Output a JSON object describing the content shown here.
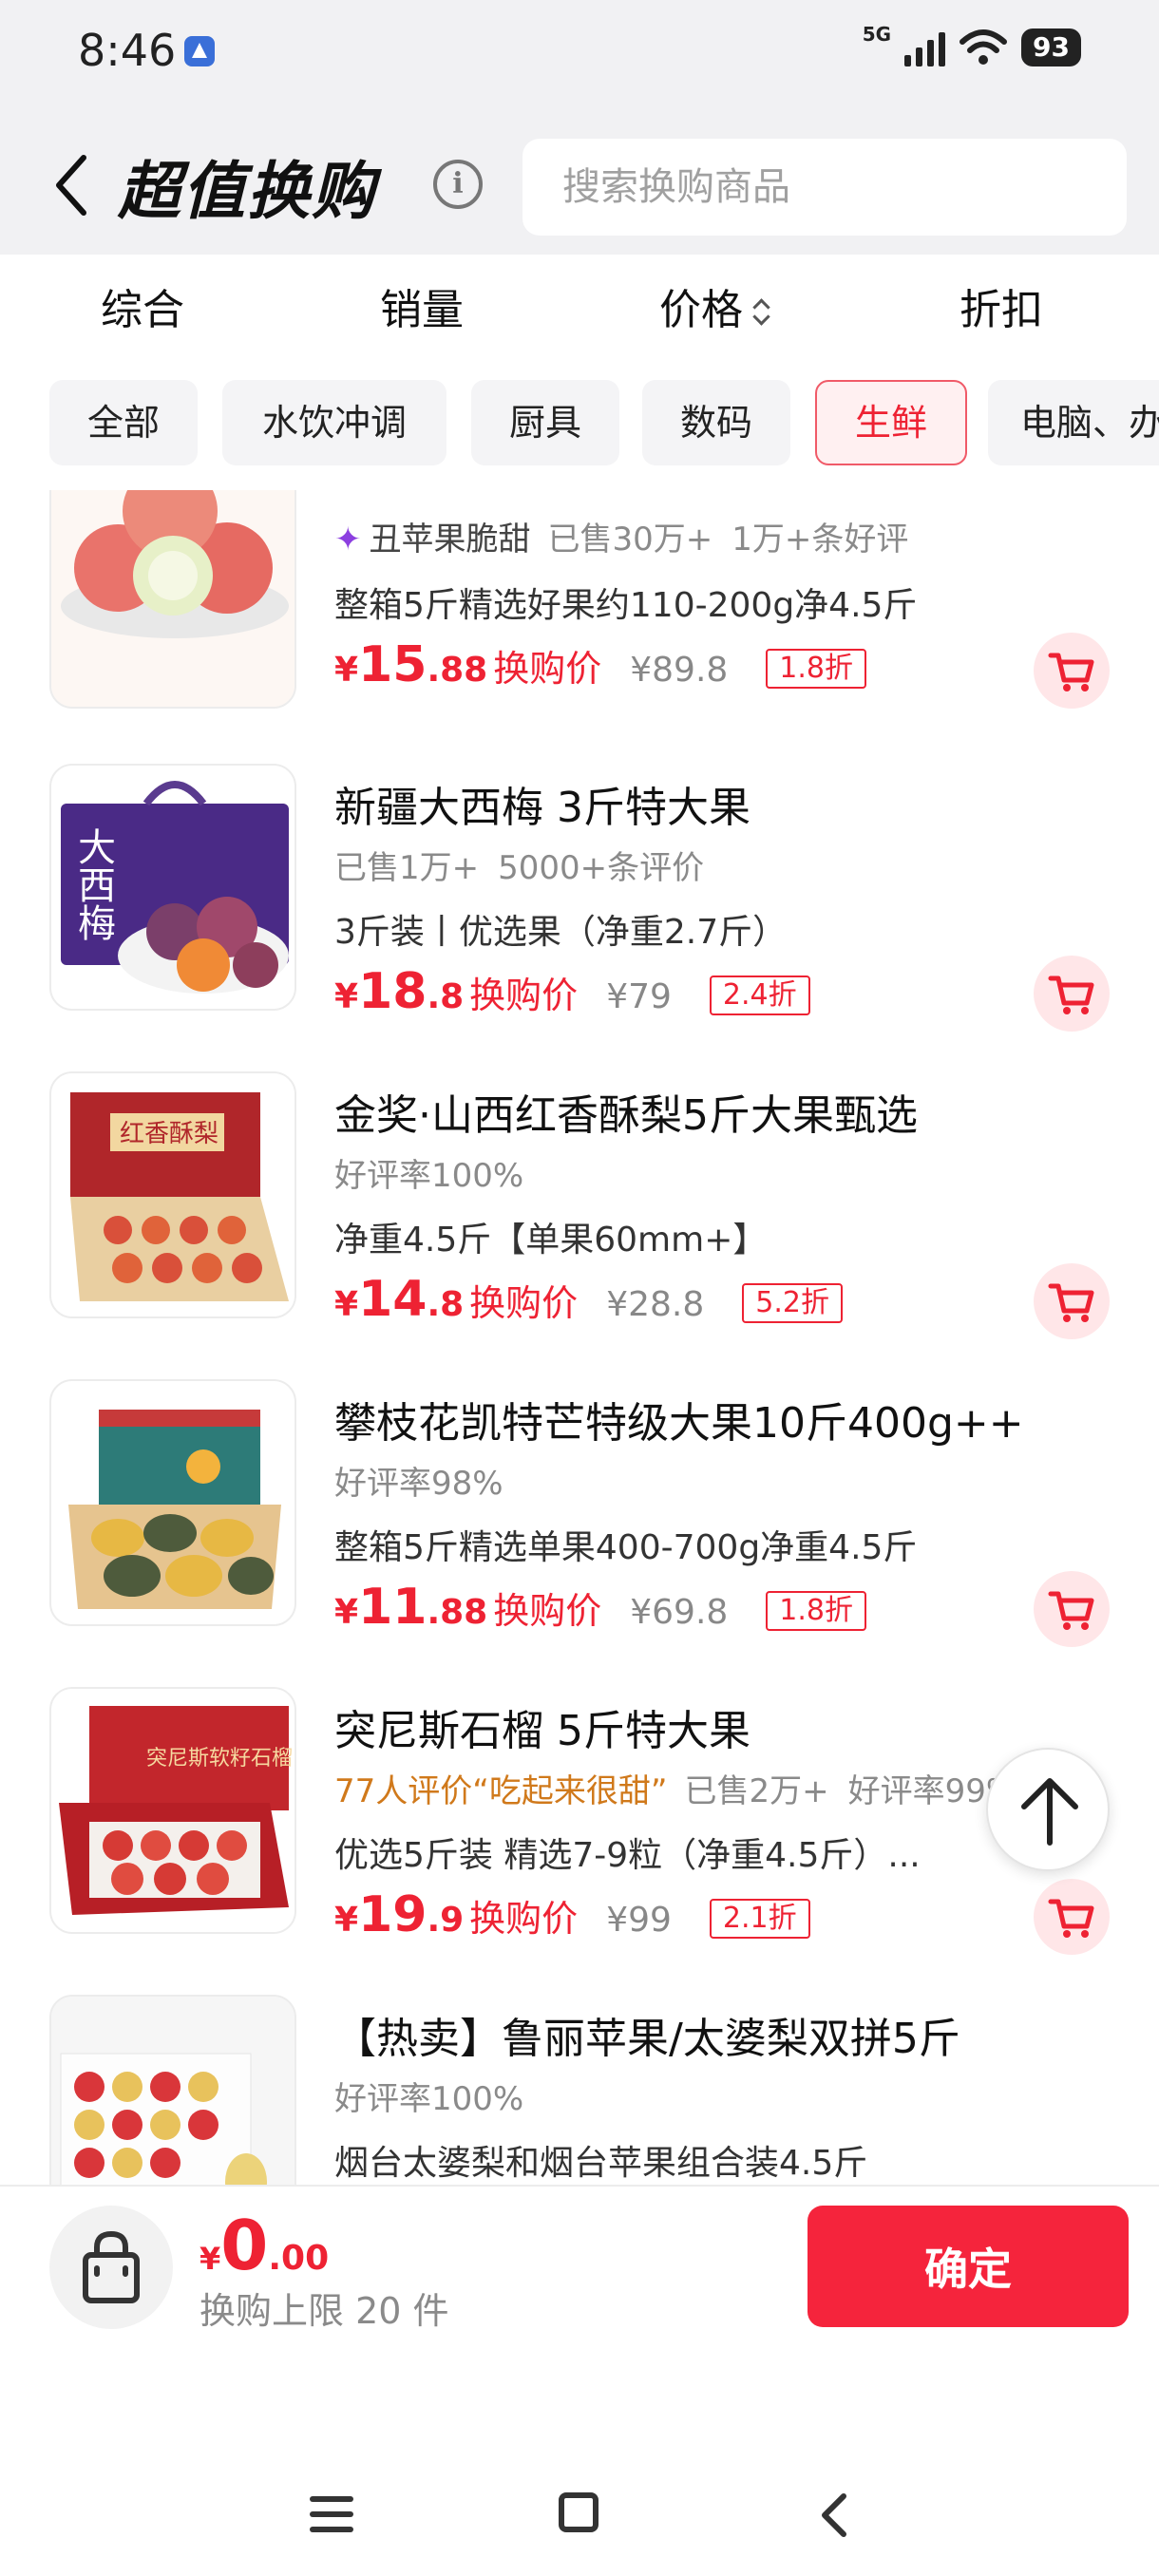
{
  "status": {
    "time": "8:46",
    "network": "5G",
    "battery": "93"
  },
  "header": {
    "title": "超值换购",
    "search_placeholder": "搜索换购商品"
  },
  "sort_tabs": [
    {
      "label": "综合"
    },
    {
      "label": "销量"
    },
    {
      "label": "价格"
    },
    {
      "label": "折扣"
    }
  ],
  "categories": [
    {
      "label": "全部"
    },
    {
      "label": "水饮冲调"
    },
    {
      "label": "厨具"
    },
    {
      "label": "数码"
    },
    {
      "label": "生鲜",
      "active": true
    },
    {
      "label": "电脑、办"
    }
  ],
  "products": [
    {
      "title": "",
      "brand": "丑苹果脆甜",
      "meta": [
        "已售30万+",
        "1万+条好评"
      ],
      "desc": "整箱5斤精选好果约110-200g净4.5斤",
      "price_int": "15",
      "price_dec": ".88",
      "price_label": "换购价",
      "orig_price": "¥89.8",
      "discount": "1.8折"
    },
    {
      "title": "新疆大西梅 3斤特大果",
      "meta": [
        "已售1万+",
        "5000+条评价"
      ],
      "desc": "3斤装丨优选果（净重2.7斤）",
      "price_int": "18",
      "price_dec": ".8",
      "price_label": "换购价",
      "orig_price": "¥79",
      "discount": "2.4折"
    },
    {
      "title": "金奖·山西红香酥梨5斤大果甄选",
      "meta": [
        "好评率100%"
      ],
      "desc": "净重4.5斤【单果60mm+】",
      "price_int": "14",
      "price_dec": ".8",
      "price_label": "换购价",
      "orig_price": "¥28.8",
      "discount": "5.2折"
    },
    {
      "title": "攀枝花凯特芒特级大果10斤400g++",
      "meta": [
        "好评率98%"
      ],
      "desc": "整箱5斤精选单果400-700g净重4.5斤",
      "price_int": "11",
      "price_dec": ".88",
      "price_label": "换购价",
      "orig_price": "¥69.8",
      "discount": "1.8折"
    },
    {
      "title": "突尼斯石榴 5斤特大果",
      "highlight": "77人评价“吃起来很甜”",
      "meta": [
        "已售2万+",
        "好评率99%"
      ],
      "desc": "优选5斤装 精选7-9粒（净重4.5斤）...",
      "price_int": "19",
      "price_dec": ".9",
      "price_label": "换购价",
      "orig_price": "¥99",
      "discount": "2.1折"
    },
    {
      "title": "【热卖】鲁丽苹果/太婆梨双拼5斤",
      "meta": [
        "好评率100%"
      ],
      "desc": "烟台太婆梨和烟台苹果组合装4.5斤",
      "price_int": "",
      "price_dec": "",
      "price_label": "",
      "orig_price": "",
      "discount": ""
    }
  ],
  "bottom_bar": {
    "currency": "¥",
    "total_int": "0",
    "total_dec": ".00",
    "limit_text": "换购上限 20 件",
    "confirm_label": "确定"
  },
  "colors": {
    "accent": "#ee2233",
    "confirm_bg": "#f5243c",
    "header_bg": "#f1f1f3"
  }
}
